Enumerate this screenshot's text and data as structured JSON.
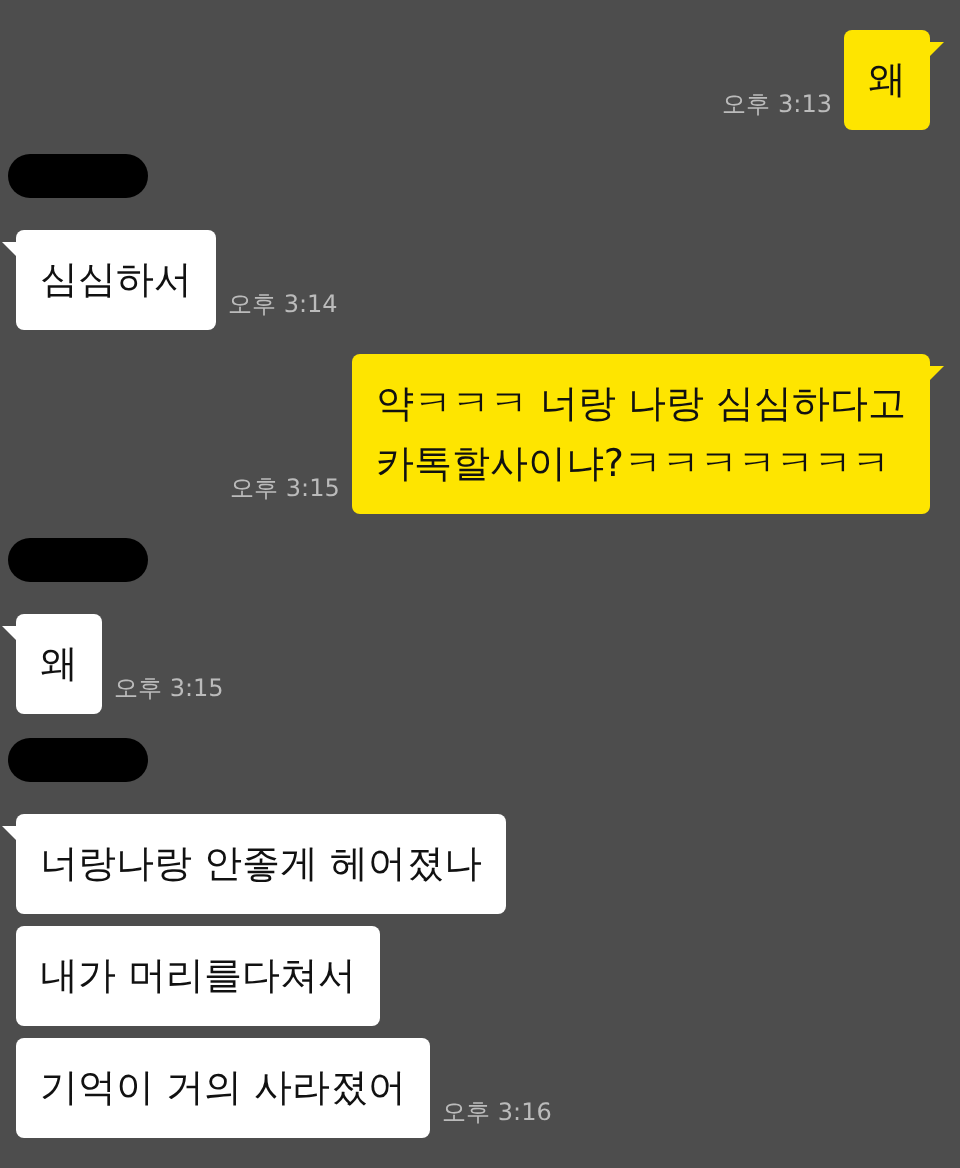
{
  "groups": [
    {
      "kind": "outgoing",
      "messages": [
        "왜"
      ],
      "time": "오후 3:13"
    },
    {
      "kind": "incoming",
      "messages": [
        "심심하서"
      ],
      "time": "오후 3:14"
    },
    {
      "kind": "outgoing",
      "messages": [
        "약ㅋㅋㅋ 너랑 나랑 심심하다고\n카톡할사이냐?ㅋㅋㅋㅋㅋㅋㅋ"
      ],
      "time": "오후 3:15"
    },
    {
      "kind": "incoming",
      "messages": [
        "왜"
      ],
      "time": "오후 3:15"
    },
    {
      "kind": "incoming",
      "messages": [
        "너랑나랑 안좋게 헤어졌나",
        "내가 머리를다쳐서",
        "기억이 거의 사라졌어"
      ],
      "time": "오후 3:16"
    }
  ]
}
